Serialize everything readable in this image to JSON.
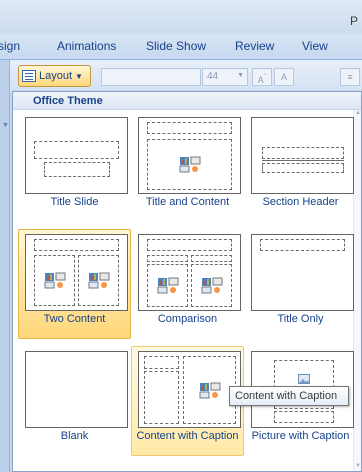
{
  "window": {
    "title_fragment": "P"
  },
  "ribbon_tabs": [
    "sign",
    "Animations",
    "Slide Show",
    "Review",
    "View"
  ],
  "toolbar": {
    "layout_label": "Layout",
    "font_size": "44"
  },
  "gallery": {
    "header": "Office Theme",
    "layouts": [
      {
        "label": "Title Slide",
        "state": "normal"
      },
      {
        "label": "Title and Content",
        "state": "normal"
      },
      {
        "label": "Section Header",
        "state": "normal"
      },
      {
        "label": "Two Content",
        "state": "selected"
      },
      {
        "label": "Comparison",
        "state": "normal"
      },
      {
        "label": "Title Only",
        "state": "normal"
      },
      {
        "label": "Blank",
        "state": "normal"
      },
      {
        "label": "Content with Caption",
        "state": "hover"
      },
      {
        "label": "Picture with Caption",
        "state": "normal"
      }
    ]
  },
  "tooltip": {
    "text": "Content with Caption"
  },
  "colors": {
    "ribbon_blue": "#15428b",
    "selected_gold": "#ffd779",
    "hover_gold": "#ffe9a6"
  }
}
